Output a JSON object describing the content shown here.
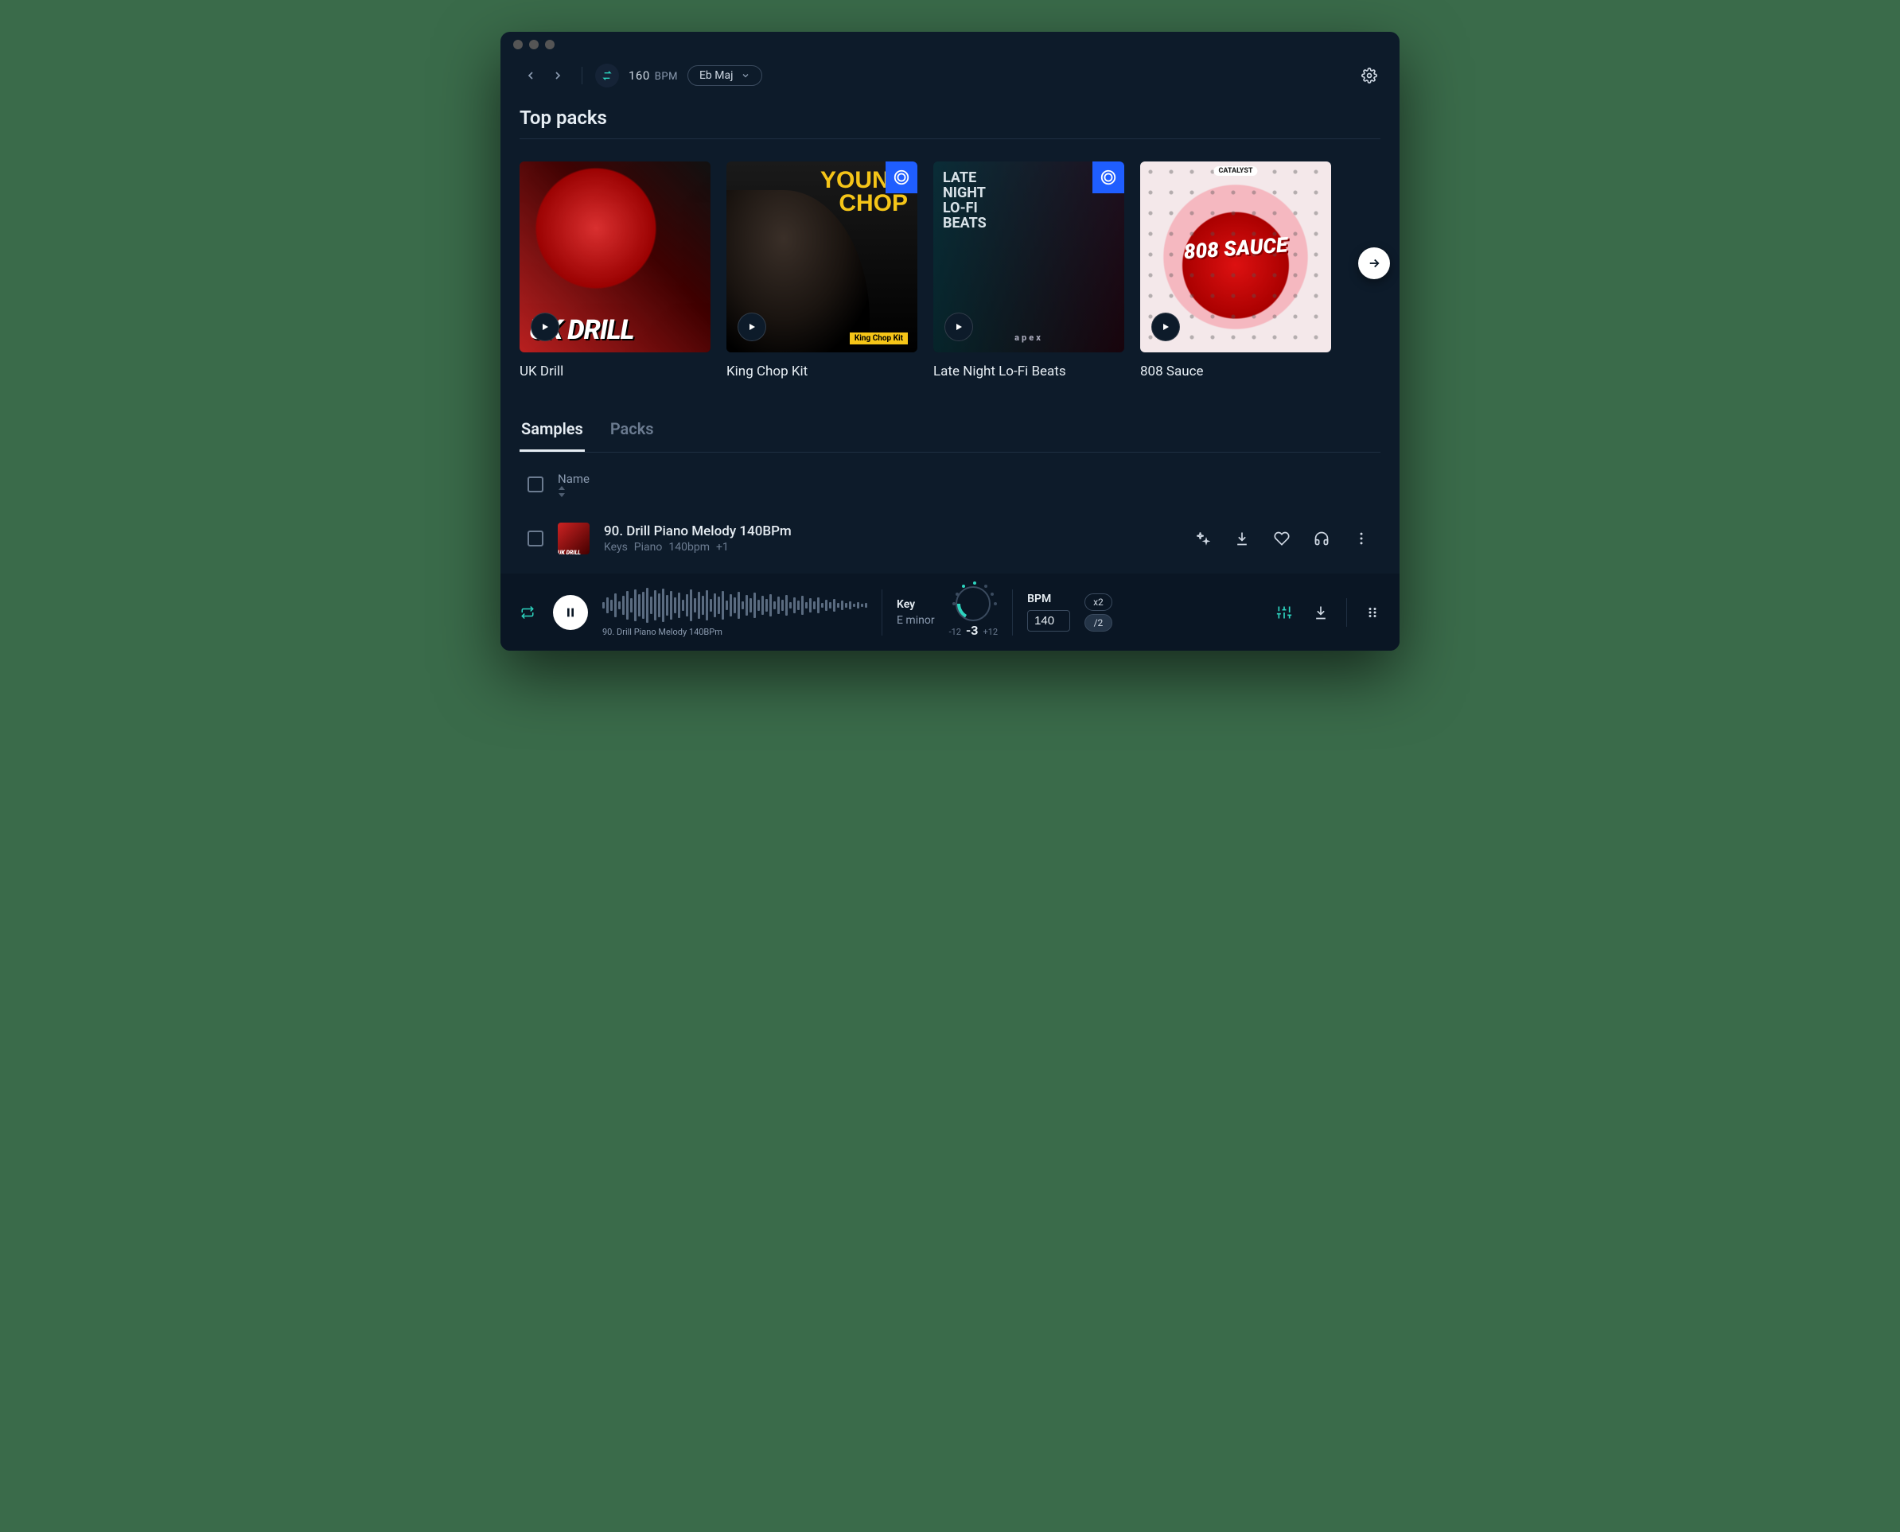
{
  "topbar": {
    "bpm_value": "160",
    "bpm_label": "BPM",
    "key": "Eb Maj"
  },
  "section_title": "Top packs",
  "packs": [
    {
      "title": "UK Drill",
      "art_text": "UK DRILL",
      "has_badge": false
    },
    {
      "title": "King Chop Kit",
      "art_text_line1": "YOUNG",
      "art_text_line2": "CHOP",
      "art_sub": "King Chop Kit",
      "has_badge": true
    },
    {
      "title": "Late Night Lo-Fi Beats",
      "art_text_line1": "LATE",
      "art_text_line2": "NIGHT",
      "art_text_line3": "LO-FI",
      "art_text_line4": "BEATS",
      "brand": "apex",
      "has_badge": true
    },
    {
      "title": "808 Sauce",
      "art_text": "808 SAUCE",
      "brand": "CATALYST",
      "has_badge": false
    }
  ],
  "tabs": {
    "samples": "Samples",
    "packs": "Packs"
  },
  "list_header": {
    "name": "Name"
  },
  "sample": {
    "name": "90. Drill Piano Melody 140BPm",
    "tags": [
      "Keys",
      "Piano",
      "140bpm",
      "+1"
    ],
    "thumb_text": "UK DRILL"
  },
  "player": {
    "now_playing": "90. Drill Piano Melody 140BPm",
    "key_label": "Key",
    "key_value": "E minor",
    "semitone_low": "-12",
    "semitone_value": "-3",
    "semitone_high": "+12",
    "bpm_label": "BPM",
    "bpm_value": "140",
    "mult_x2": "x2",
    "mult_half": "/2"
  }
}
